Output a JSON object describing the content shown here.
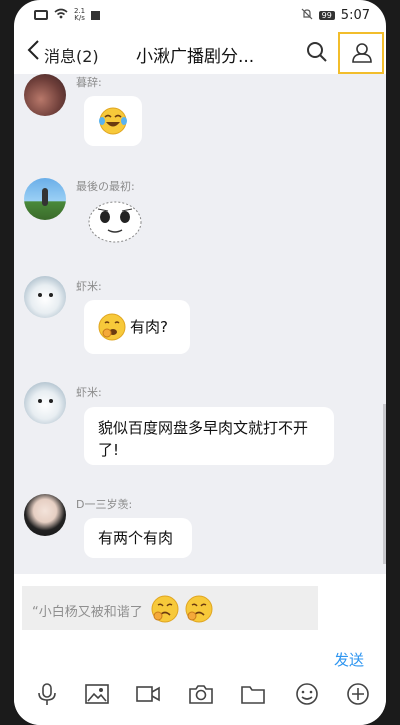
{
  "status_bar": {
    "speed_value": "2.1",
    "speed_unit": "K/s",
    "battery": "99",
    "time": "5:07"
  },
  "header": {
    "back_label": "消息(2)",
    "title": "小湫广播剧分..."
  },
  "messages": [
    {
      "sender": "暮辞:",
      "type": "emoji",
      "emoji": "laughing-tears-emoji"
    },
    {
      "sender": "最後の最初:",
      "type": "sticker",
      "sticker": "cartoon-face-sticker"
    },
    {
      "sender": "虾米:",
      "type": "text",
      "emoji": "yawning-face-emoji",
      "text": "有肉?"
    },
    {
      "sender": "虾米:",
      "type": "text",
      "text": "貌似百度网盘多早肉文就打不开了!"
    },
    {
      "sender": "D一三岁羡:",
      "type": "text",
      "text": "有两个有肉"
    }
  ],
  "input": {
    "value": "“小白杨又被和谐了",
    "emojis": [
      "sob-emoji",
      "sob-emoji"
    ],
    "send_label": "发送"
  },
  "toolbar": [
    "mic-icon",
    "image-icon",
    "video-icon",
    "camera-icon",
    "folder-icon",
    "smiley-icon",
    "plus-icon"
  ],
  "colors": {
    "chat_bg": "#eeeff3",
    "send_blue": "#2d95f0",
    "highlight": "#f2bd2b"
  }
}
